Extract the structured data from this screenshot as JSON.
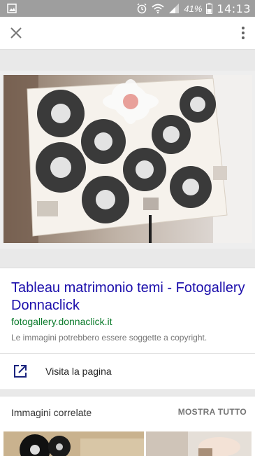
{
  "status": {
    "battery": "41%",
    "time": "14:13"
  },
  "card": {
    "title": "Tableau matrimonio temi - Fotogallery Donnaclick",
    "url": "fotogallery.donnaclick.it",
    "copyright": "Le immagini potrebbero essere soggette a copyright.",
    "visit_label": "Visita la pagina"
  },
  "related": {
    "title": "Immagini correlate",
    "show_all": "MOSTRA TUTTO"
  }
}
